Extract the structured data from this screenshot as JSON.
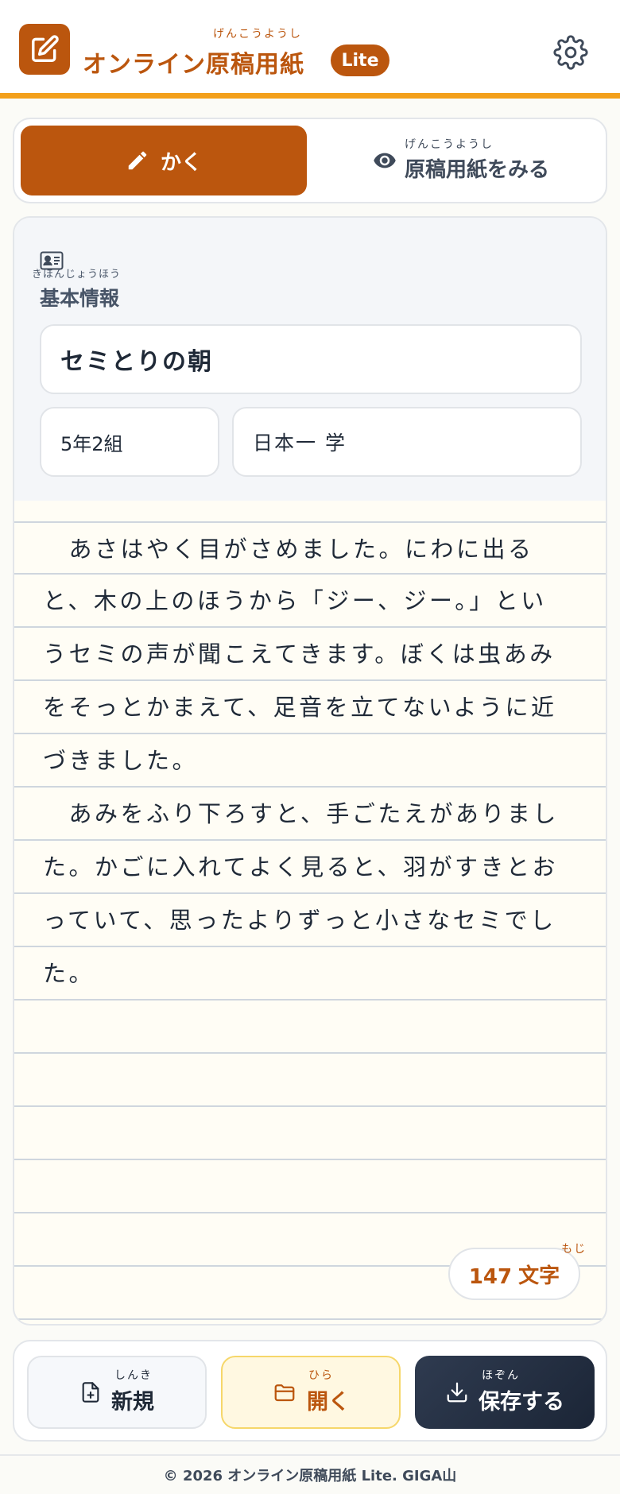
{
  "header": {
    "app_title": "オンライン原稿用紙",
    "title_ruby": "げんこうようし",
    "badge": "Lite",
    "logo_icon": "edit-icon",
    "settings_icon": "gear-icon",
    "accent_color": "#bb560e",
    "bar_color": "#f3a01b"
  },
  "tabs": [
    {
      "label": "かく",
      "icon": "pencil-icon",
      "active": true
    },
    {
      "label": "原稿用紙をみる",
      "ruby": "げんこうようし",
      "icon": "eye-icon",
      "active": false
    }
  ],
  "info": {
    "heading": "基本情報",
    "heading_ruby": "きほんじょうほう",
    "icon": "id-card-icon",
    "title_value": "セミとりの朝",
    "class_value": "5年2組",
    "name_value": "日本一 学"
  },
  "manuscript": {
    "rows": [
      "　あさはやく目がさめました。にわに出る",
      "と、木の上のほうから「ジー、ジー。」とい",
      "うセミの声が聞こえてきます。ぼくは虫あみ",
      "をそっとかまえて、足音を立てないように近",
      "づきました。",
      "　あみをふり下ろすと、手ごたえがありまし",
      "た。かごに入れてよく見ると、羽がすきとお",
      "っていて、思ったよりずっと小さなセミでし",
      "た。",
      "",
      "",
      "",
      "",
      "",
      "",
      ""
    ],
    "char_count": "147",
    "char_unit": "文字",
    "char_unit_ruby": "もじ"
  },
  "actions": {
    "new": {
      "label": "新規",
      "ruby": "しんき",
      "icon": "new-file-icon"
    },
    "open": {
      "label": "開く",
      "ruby": "ひら",
      "icon": "folder-icon"
    },
    "save": {
      "label": "保存する",
      "ruby": "ほぞん",
      "icon": "download-icon"
    }
  },
  "footer": {
    "text": "© 2026 オンライン原稿用紙 Lite. GIGA山"
  }
}
